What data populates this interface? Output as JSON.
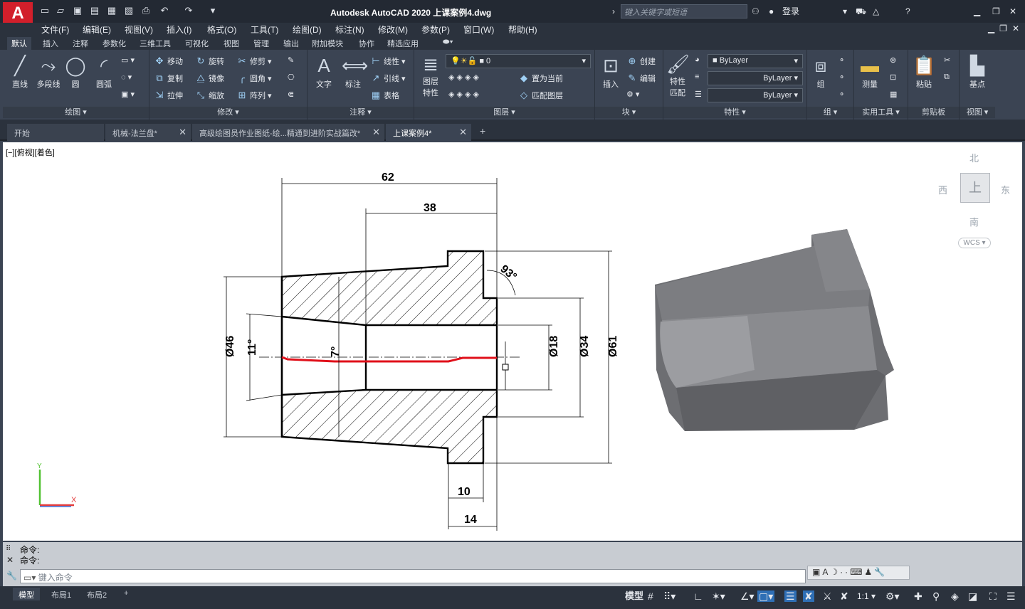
{
  "app": {
    "logo": "A",
    "title": "Autodesk AutoCAD 2020    上课案例4.dwg",
    "search_placeholder": "键入关键字或短语",
    "login": "登录"
  },
  "menu": [
    "文件(F)",
    "编辑(E)",
    "视图(V)",
    "插入(I)",
    "格式(O)",
    "工具(T)",
    "绘图(D)",
    "标注(N)",
    "修改(M)",
    "参数(P)",
    "窗口(W)",
    "帮助(H)"
  ],
  "ribbon_tabs": [
    "默认",
    "插入",
    "注释",
    "参数化",
    "三维工具",
    "可视化",
    "视图",
    "管理",
    "输出",
    "附加模块",
    "协作",
    "精选应用"
  ],
  "panels": {
    "draw": {
      "title": "绘图",
      "line": "直线",
      "polyline": "多段线",
      "circle": "圆",
      "arc": "圆弧"
    },
    "modify": {
      "title": "修改",
      "move": "移动",
      "rotate": "旋转",
      "trim": "修剪",
      "copy": "复制",
      "mirror": "镜像",
      "fillet": "圆角",
      "stretch": "拉伸",
      "scale": "缩放",
      "array": "阵列"
    },
    "annotation": {
      "title": "注释",
      "text": "文字",
      "dimension": "标注",
      "linear": "线性",
      "leader": "引线",
      "table": "表格"
    },
    "layers": {
      "title": "图层",
      "props": "图层\n特性",
      "layer_name": "0",
      "make_current": "置为当前",
      "match_layer": "匹配图层"
    },
    "block": {
      "title": "块",
      "insert": "插入",
      "create": "创建",
      "edit": "编辑"
    },
    "properties": {
      "title": "特性",
      "match": "特性\n匹配",
      "color": "ByLayer",
      "linetype": "ByLayer",
      "lineweight": "ByLayer"
    },
    "groups": {
      "title": "组",
      "group": "组"
    },
    "utilities": {
      "title": "实用工具",
      "measure": "测量"
    },
    "clipboard": {
      "title": "剪贴板",
      "paste": "粘贴"
    },
    "view": {
      "title": "视图",
      "base": "基点"
    }
  },
  "file_tabs": [
    {
      "label": "开始"
    },
    {
      "label": "机械-法兰盘*"
    },
    {
      "label": "高级绘图员作业图纸-绘...精通到进阶实战篇改*"
    },
    {
      "label": "上课案例4*"
    }
  ],
  "viewport": {
    "label": "[−][俯视][着色]",
    "cube": {
      "north": "北",
      "south": "南",
      "east": "东",
      "west": "西",
      "top": "上",
      "wcs": "WCS"
    }
  },
  "drawing": {
    "dims": {
      "d62": "62",
      "d38": "38",
      "d10": "10",
      "d14": "14",
      "a93": "93°",
      "a11": "11°",
      "a7": "7°",
      "dia46": "Ø46",
      "dia18": "Ø18",
      "dia34": "Ø34",
      "dia61": "Ø61"
    }
  },
  "command": {
    "history": [
      "命令:",
      "命令:"
    ],
    "placeholder": "键入命令"
  },
  "status": {
    "tabs": [
      "模型",
      "布局1",
      "布局2"
    ],
    "model": "模型",
    "scale": "1:1"
  },
  "colors": {
    "accent": "#d21f2b",
    "ribbon": "#3b4453",
    "canvas": "#ffffff",
    "highlight": "#e0101a"
  }
}
